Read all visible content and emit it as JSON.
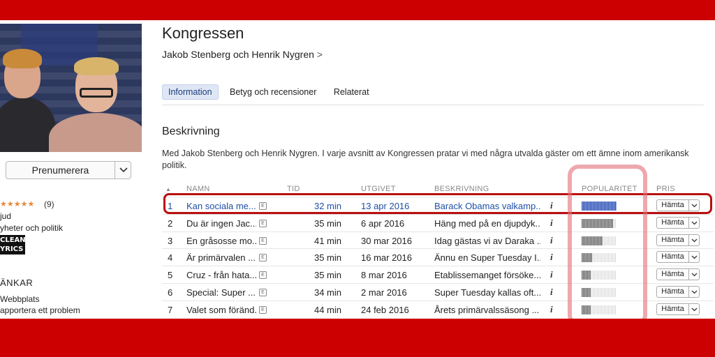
{
  "podcast": {
    "title": "Kongressen",
    "authors": "Jakob Stenberg och Henrik Nygren",
    "author_chevron": ">",
    "subscribe_label": "Prenumerera",
    "rating_stars": "★★★★★",
    "rating_count": "(9)",
    "meta_1": "jud",
    "meta_2": "yheter och politik",
    "clean_badge_1": "CLEAN",
    "clean_badge_2": "YRICS",
    "links_heading": "ÄNKAR",
    "link_1": "Webbplats",
    "link_2": "apportera ett problem"
  },
  "tabs": [
    "Information",
    "Betyg och recensioner",
    "Relaterat"
  ],
  "description": {
    "heading": "Beskrivning",
    "text": "Med Jakob Stenberg och Henrik Nygren. I varje avsnitt av Kongressen pratar vi med några utvalda gäster om ett ämne inom amerikansk politik."
  },
  "table": {
    "sort_arrow": "▲",
    "headers": {
      "name": "NAMN",
      "time": "TID",
      "released": "UTGIVET",
      "description": "BESKRIVNING",
      "popularity": "POPULARITET",
      "price": "PRIS"
    },
    "button_label": "Hämta",
    "explicit_badge": "E",
    "info_icon": "i",
    "rows": [
      {
        "num": "1",
        "title": "Kan sociala me...",
        "time": "32 min",
        "date": "13 apr 2016",
        "desc": "Barack Obamas valkamp...",
        "popularity": 1.0
      },
      {
        "num": "2",
        "title": "Du är ingen Jac...",
        "time": "35 min",
        "date": "6 apr 2016",
        "desc": "Häng med på en djupdyk...",
        "popularity": 0.9
      },
      {
        "num": "3",
        "title": "En gråsosse mo...",
        "time": "41 min",
        "date": "30 mar 2016",
        "desc": "Idag gästas vi av Daraka ...",
        "popularity": 0.6
      },
      {
        "num": "4",
        "title": "Är primärvalen ...",
        "time": "35 min",
        "date": "16 mar 2016",
        "desc": "Ännu en Super Tuesday I...",
        "popularity": 0.3
      },
      {
        "num": "5",
        "title": "Cruz - från hata...",
        "time": "35 min",
        "date": "8 mar 2016",
        "desc": "Etablissemanget försöke...",
        "popularity": 0.25
      },
      {
        "num": "6",
        "title": "Special: Super ...",
        "time": "34 min",
        "date": "2 mar 2016",
        "desc": "Super Tuesday kallas oft...",
        "popularity": 0.25
      },
      {
        "num": "7",
        "title": "Valet som föränd...",
        "time": "44 min",
        "date": "24 feb 2016",
        "desc": "Årets primärvalssäsong ...",
        "popularity": 0.25
      }
    ]
  },
  "colors": {
    "frame_red": "#cc0000",
    "highlight_red": "#b80f0f",
    "selected_blue": "#1d4fa8"
  }
}
